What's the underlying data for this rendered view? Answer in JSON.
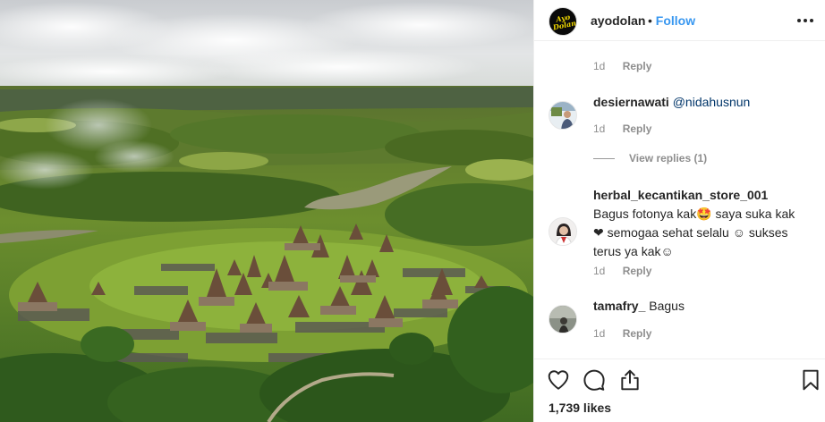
{
  "photo": {
    "description_icon": "landscape-photo"
  },
  "post": {
    "username": "ayodolan",
    "separator": "•",
    "follow_label": "Follow",
    "avatar_text": "Ayo Dolan",
    "more_icon": "more-horizontal-icon"
  },
  "comments": [
    {
      "time": "1d",
      "reply_label": "Reply"
    },
    {
      "username": "desiernawati",
      "mention": "@nidahusnun",
      "time": "1d",
      "reply_label": "Reply",
      "view_replies": "View replies (1)"
    },
    {
      "username": "herbal_kecantikan_store_001",
      "text_line1": "Bagus",
      "text_line2": "fotonya kak",
      "emoji1": "🤩",
      "text_line2b": " saya suka kak ",
      "heart": "❤",
      "text_line3": "semogaa sehat selalu ",
      "smile1": "☺",
      "text_line3b": " sukses terus",
      "text_line4": "ya kak",
      "smile2": "☺",
      "time": "1d",
      "reply_label": "Reply"
    },
    {
      "username": "tamafry_",
      "text": "Bagus",
      "time": "1d",
      "reply_label": "Reply"
    }
  ],
  "actions": {
    "like_icon": "heart-icon",
    "comment_icon": "comment-icon",
    "share_icon": "share-icon",
    "save_icon": "bookmark-icon",
    "likes": "1,739 likes"
  },
  "colors": {
    "link": "#3897f0",
    "mention": "#003569",
    "muted": "#8e8e8e",
    "text": "#262626",
    "border": "#efefef"
  }
}
